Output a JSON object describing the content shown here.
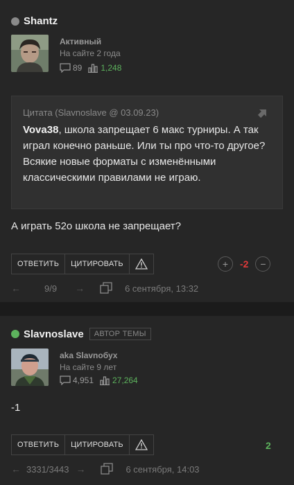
{
  "post1": {
    "author": "Shantz",
    "status_color": "#8a8a8a",
    "role": "Активный",
    "on_site": "На сайте 2 года",
    "messages": "89",
    "reputation": "1,248",
    "quote": {
      "header": "Цитата (Slavnoslave @ 03.09.23)",
      "bold_name": "Vova38",
      "line1_rest": ", школа запрещает 6 макс турниры. А так играл конечно раньше. Или ты про что-то другое?",
      "line2": "Всякие новые форматы с изменёнными классическими правилами не играю."
    },
    "text": "А играть 52о школа не запрещает?",
    "buttons": {
      "reply": "ОТВЕТИТЬ",
      "quote": "ЦИТИРОВАТЬ"
    },
    "score": "-2",
    "page": "9/9",
    "date": "6 сентября, 13:32"
  },
  "post2": {
    "author": "Slavnoslave",
    "status_color": "#5db35d",
    "badge": "АВТОР ТЕМЫ",
    "role": "aka Slavnобух",
    "on_site": "На сайте 9 лет",
    "messages": "4,951",
    "reputation": "27,264",
    "text": "-1",
    "buttons": {
      "reply": "ОТВЕТИТЬ",
      "quote": "ЦИТИРОВАТЬ"
    },
    "score": "2",
    "page": "3331/3443",
    "date": "6 сентября, 14:03"
  },
  "colors": {
    "positive": "#5db35d",
    "negative": "#e23a3a",
    "online": "#5db35d",
    "offline": "#8a8a8a"
  }
}
